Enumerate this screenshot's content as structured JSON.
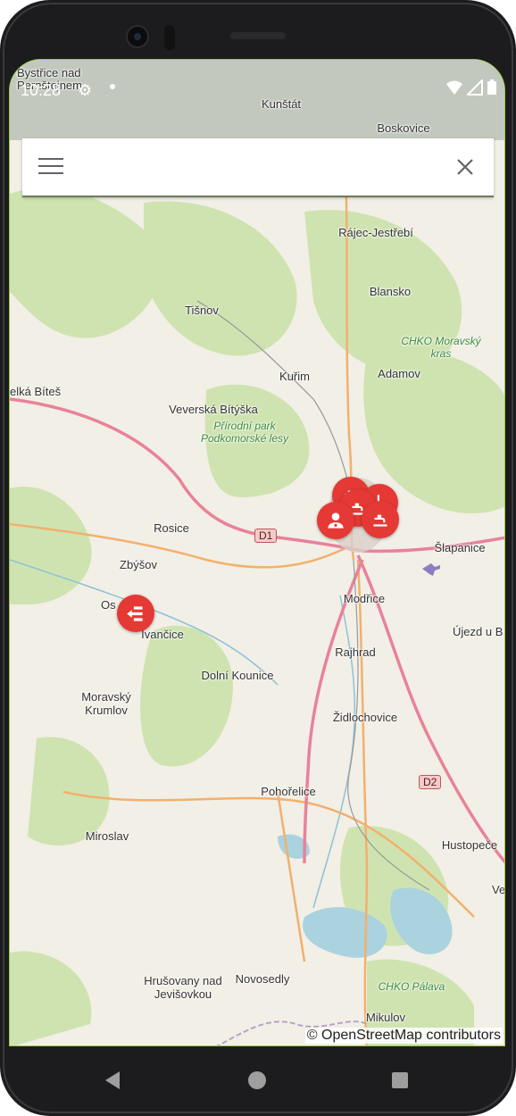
{
  "status_bar": {
    "time": "10:28",
    "icons": [
      "settings-gear-icon",
      "notification-dot-icon",
      "wifi-icon",
      "cellular-signal-icon",
      "battery-icon"
    ]
  },
  "search": {
    "value": "",
    "placeholder": ""
  },
  "map": {
    "places": {
      "bystrice": "Bystřice nad",
      "bystrice2": "Pernštejnem",
      "kunstat": "Kunštát",
      "boskovice": "Boskovice",
      "rajec": "Rájec-Jestřebí",
      "blansko": "Blansko",
      "tisnov": "Tišnov",
      "chko_moravsky": "CHKO Moravský kras",
      "kurim": "Kuřim",
      "adamov": "Adamov",
      "velka_bites": "elká Bíteš",
      "veverska": "Veverská Bítýška",
      "podkomorske": "Přírodní park Podkomorské lesy",
      "rosice": "Rosice",
      "slapanice": "Šlapanice",
      "zbysov": "Zbýšov",
      "oslavany": "Os",
      "modrice": "Modřice",
      "ivancice": "Ivančice",
      "ujezd": "Újezd u B",
      "rajhrad": "Rajhrad",
      "dolni_kounice": "Dolní Kounice",
      "moravsky_krumlov": "Moravský Krumlov",
      "zidlochovice": "Židlochovice",
      "pohorelice": "Pohořelice",
      "miroslav": "Miroslav",
      "hustopece": "Hustopeče",
      "ve": "Ve",
      "hrusovany": "Hrušovany nad Jevišovkou",
      "novosedly": "Novosedly",
      "chko_palava": "CHKO Pálava",
      "mikulov": "Mikulov"
    },
    "roads": {
      "d1": "D1",
      "d2": "D2"
    },
    "markers": [
      "faucet-icon",
      "faucet-icon",
      "faucet-icon",
      "faucet-icon",
      "worker-icon",
      "pipe-direction-icon"
    ],
    "colors": {
      "marker": "#e53935",
      "motorway": "#e8829a",
      "primary": "#f2b06d",
      "forest": "#cfe3b1",
      "water": "#aad3df"
    }
  },
  "attribution": "© OpenStreetMap contributors",
  "nav": {
    "back": "back-icon",
    "home": "home-icon",
    "recents": "recents-icon"
  }
}
